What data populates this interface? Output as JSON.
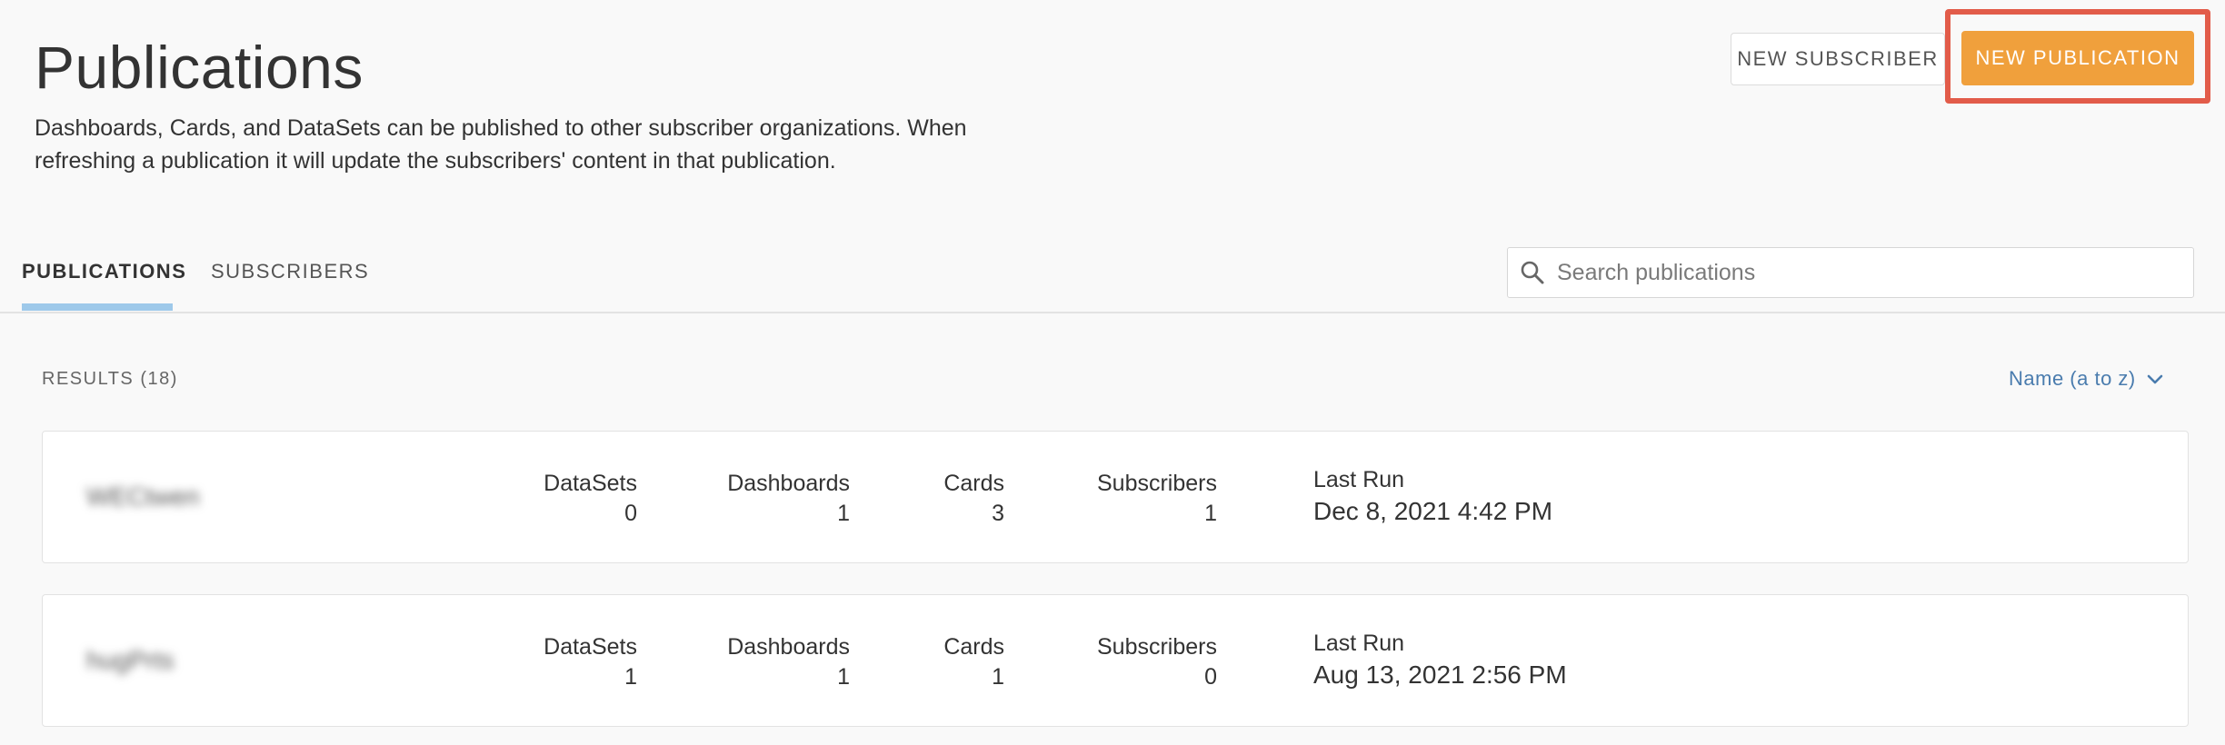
{
  "header": {
    "title": "Publications",
    "description": "Dashboards, Cards, and DataSets can be published to other subscriber organizations. When refreshing a publication it will update the subscribers' content in that publication.",
    "new_subscriber_label": "NEW SUBSCRIBER",
    "new_publication_label": "NEW PUBLICATION"
  },
  "tabs": [
    {
      "label": "PUBLICATIONS",
      "active": true
    },
    {
      "label": "SUBSCRIBERS",
      "active": false
    }
  ],
  "search": {
    "placeholder": "Search publications",
    "value": ""
  },
  "results": {
    "count_label": "RESULTS (18)",
    "sort_label": "Name (a to z)"
  },
  "publications": [
    {
      "name": "WECtwen",
      "datasets_label": "DataSets",
      "datasets": "0",
      "dashboards_label": "Dashboards",
      "dashboards": "1",
      "cards_label": "Cards",
      "cards": "3",
      "subscribers_label": "Subscribers",
      "subscribers": "1",
      "last_run_label": "Last Run",
      "last_run": "Dec 8, 2021 4:42 PM"
    },
    {
      "name": "hugPrts",
      "datasets_label": "DataSets",
      "datasets": "1",
      "dashboards_label": "Dashboards",
      "dashboards": "1",
      "cards_label": "Cards",
      "cards": "1",
      "subscribers_label": "Subscribers",
      "subscribers": "0",
      "last_run_label": "Last Run",
      "last_run": "Aug 13, 2021 2:56 PM"
    }
  ],
  "colors": {
    "accent_orange": "#f0a03c",
    "highlight_red": "#e25c4a",
    "tab_indicator": "#9ec9ea",
    "link_blue": "#4a7cae"
  }
}
